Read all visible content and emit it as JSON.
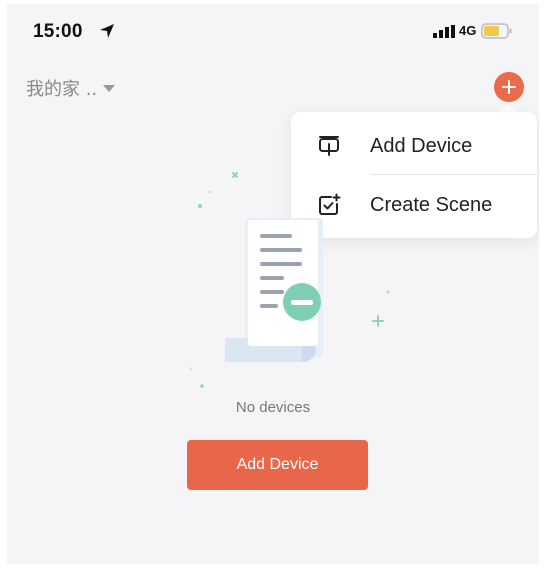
{
  "status_bar": {
    "time": "15:00",
    "network": "4G",
    "icons": [
      "location-arrow-icon",
      "signal-icon",
      "battery-icon"
    ]
  },
  "header": {
    "home_name": "我的家 ..",
    "add_icon": "plus-icon"
  },
  "menu": {
    "items": [
      {
        "label": "Add Device",
        "icon": "add-device-icon"
      },
      {
        "label": "Create Scene",
        "icon": "create-scene-icon"
      }
    ]
  },
  "empty_state": {
    "message": "No devices",
    "button_label": "Add Device"
  },
  "colors": {
    "accent": "#e8664a",
    "illustration_green": "#7fd0b2",
    "illustration_blue": "#dbe6f4",
    "background": "#f5f5f7"
  }
}
